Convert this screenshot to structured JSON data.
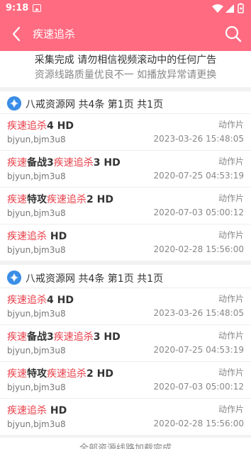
{
  "status_bar": {
    "time": "9:18",
    "icons": [
      "image-notification-icon",
      "wifi-icon",
      "signal-icon",
      "battery-icon"
    ]
  },
  "app_bar": {
    "title": "疾速追杀",
    "back_icon": "back-arrow-icon",
    "search_icon": "search-icon"
  },
  "notice": {
    "line1": "采集完成 请勿相信视频滚动中的任何广告",
    "line2": "资源线路质量优良不一 如播放异常请更换"
  },
  "groups": [
    {
      "header": "八戒资源网 共4条 第1页 共1页",
      "items": [
        {
          "parts": [
            {
              "t": "疾速追杀",
              "hl": true
            },
            {
              "t": "4 HD",
              "hl": false
            }
          ],
          "category": "动作片",
          "tags": "bjyun,bjm3u8",
          "date": "2023-03-26 15:48:05"
        },
        {
          "parts": [
            {
              "t": "疾速",
              "hl": true
            },
            {
              "t": "备战3",
              "hl": false
            },
            {
              "t": "疾速追杀",
              "hl": true
            },
            {
              "t": "3 HD",
              "hl": false
            }
          ],
          "category": "动作片",
          "tags": "bjyun,bjm3u8",
          "date": "2020-07-25 04:53:19"
        },
        {
          "parts": [
            {
              "t": "疾速",
              "hl": true
            },
            {
              "t": "特攻",
              "hl": false
            },
            {
              "t": "疾速追杀",
              "hl": true
            },
            {
              "t": "2 HD",
              "hl": false
            }
          ],
          "category": "动作片",
          "tags": "bjyun,bjm3u8",
          "date": "2020-07-03 05:00:12"
        },
        {
          "parts": [
            {
              "t": "疾速追杀",
              "hl": true
            },
            {
              "t": " HD",
              "hl": false
            }
          ],
          "category": "动作片",
          "tags": "bjyun,bjm3u8",
          "date": "2020-02-28 15:56:00"
        }
      ]
    },
    {
      "header": "八戒资源网 共4条 第1页 共1页",
      "items": [
        {
          "parts": [
            {
              "t": "疾速追杀",
              "hl": true
            },
            {
              "t": "4 HD",
              "hl": false
            }
          ],
          "category": "动作片",
          "tags": "bjyun,bjm3u8",
          "date": "2023-03-26 15:48:05"
        },
        {
          "parts": [
            {
              "t": "疾速",
              "hl": true
            },
            {
              "t": "备战3",
              "hl": false
            },
            {
              "t": "疾速追杀",
              "hl": true
            },
            {
              "t": "3 HD",
              "hl": false
            }
          ],
          "category": "动作片",
          "tags": "bjyun,bjm3u8",
          "date": "2020-07-25 04:53:19"
        },
        {
          "parts": [
            {
              "t": "疾速",
              "hl": true
            },
            {
              "t": "特攻",
              "hl": false
            },
            {
              "t": "疾速追杀",
              "hl": true
            },
            {
              "t": "2 HD",
              "hl": false
            }
          ],
          "category": "动作片",
          "tags": "bjyun,bjm3u8",
          "date": "2020-07-03 05:00:12"
        },
        {
          "parts": [
            {
              "t": "疾速追杀",
              "hl": true
            },
            {
              "t": " HD",
              "hl": false
            }
          ],
          "category": "动作片",
          "tags": "bjyun,bjm3u8",
          "date": "2020-02-28 15:56:00"
        }
      ]
    }
  ],
  "footer": "全部资源线路加载完成",
  "colors": {
    "accent": "#ff6b81",
    "highlight": "#e8414b",
    "source_icon": "#3a8ee6"
  }
}
